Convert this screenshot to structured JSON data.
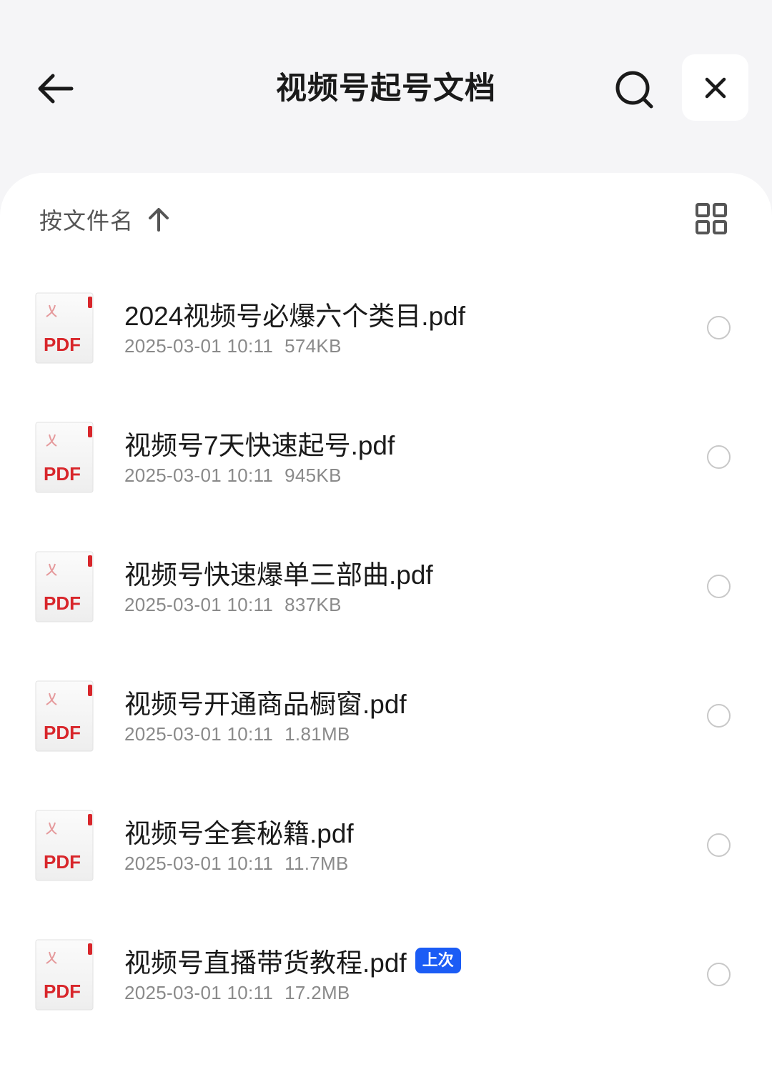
{
  "header": {
    "title": "视频号起号文档",
    "back_icon": "arrow-left-icon",
    "search_icon": "search-icon",
    "close_icon": "close-icon"
  },
  "toolbar": {
    "sort_label": "按文件名",
    "sort_direction_icon": "arrow-up-icon",
    "view_toggle_icon": "grid-view-icon"
  },
  "files": [
    {
      "name": "2024视频号必爆六个类目.pdf",
      "date": "2025-03-01 10:11",
      "size": "574KB",
      "badge": ""
    },
    {
      "name": "视频号7天快速起号.pdf",
      "date": "2025-03-01 10:11",
      "size": "945KB",
      "badge": ""
    },
    {
      "name": "视频号快速爆单三部曲.pdf",
      "date": "2025-03-01 10:11",
      "size": "837KB",
      "badge": ""
    },
    {
      "name": "视频号开通商品橱窗.pdf",
      "date": "2025-03-01 10:11",
      "size": "1.81MB",
      "badge": ""
    },
    {
      "name": "视频号全套秘籍.pdf",
      "date": "2025-03-01 10:11",
      "size": "11.7MB",
      "badge": ""
    },
    {
      "name": "视频号直播带货教程.pdf",
      "date": "2025-03-01 10:11",
      "size": "17.2MB",
      "badge": "上次"
    }
  ],
  "file_icon": {
    "label": "PDF",
    "name": "pdf-file-icon"
  },
  "colors": {
    "background": "#f5f5f7",
    "panel": "#ffffff",
    "pdf_red": "#d8262b",
    "badge_blue": "#1b5cf5",
    "meta_gray": "#8a8a8a"
  }
}
